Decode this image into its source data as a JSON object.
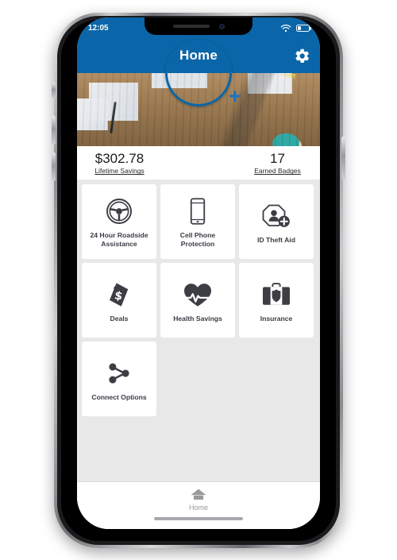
{
  "device": {
    "status_bar": {
      "time": "12:05",
      "wifi_icon": "wifi-icon",
      "battery_icon": "battery-icon"
    },
    "notch": {
      "speaker_icon": "speaker-grille-icon",
      "camera_icon": "front-camera-icon"
    },
    "home_indicator": "home-indicator"
  },
  "appbar": {
    "title": "Home",
    "settings_icon": "gear-icon"
  },
  "hero": {
    "avatar_icon": "user-avatar",
    "add_icon": "plus-icon",
    "accent_color": "#0a66a8"
  },
  "stats": [
    {
      "value": "$302.78",
      "label": "Lifetime Savings"
    },
    {
      "value": "17",
      "label": "Earned Badges"
    }
  ],
  "tiles": [
    {
      "label": "24 Hour Roadside Assistance",
      "icon": "steering-wheel-icon"
    },
    {
      "label": "Cell Phone Protection",
      "icon": "smartphone-icon"
    },
    {
      "label": "ID Theft Aid",
      "icon": "id-theft-shield-icon"
    },
    {
      "label": "Deals",
      "icon": "price-tag-dollar-icon"
    },
    {
      "label": "Health Savings",
      "icon": "heart-pulse-icon"
    },
    {
      "label": "Insurance",
      "icon": "briefcase-shield-icon"
    },
    {
      "label": "Connect Options",
      "icon": "share-nodes-icon"
    }
  ],
  "bottom_nav": [
    {
      "label": "Home",
      "icon": "home-icon",
      "active": true
    }
  ],
  "colors": {
    "brand_blue": "#0a66a8",
    "plus_blue": "#1a73c4",
    "tile_bg": "#ffffff",
    "screen_bg": "#e8e8e8",
    "icon_dark": "#3d3d44",
    "nav_inactive": "#9a9a9e"
  }
}
